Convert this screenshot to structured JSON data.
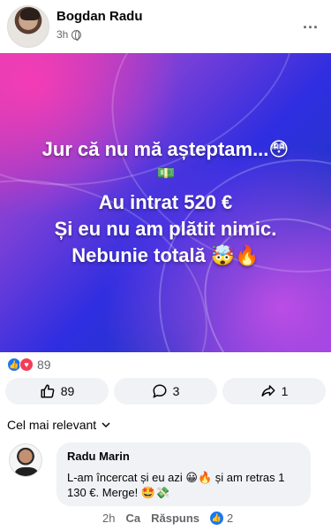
{
  "post": {
    "author": "Bogdan Radu",
    "time": "3h",
    "privacy_icon": "globe-icon",
    "more_icon": "more-options-icon",
    "more_label": "..."
  },
  "image": {
    "line1": "Jur că nu mă așteptam...😳",
    "money_emoji": "💵",
    "line2": "Au intrat 520 €",
    "line3": "Și eu nu am plătit nimic.",
    "line4": "Nebunie totală 🤯🔥",
    "colors": {
      "primary": "#2f2ee0",
      "accent": "#d23fb0"
    }
  },
  "reactions": {
    "count": "89",
    "icons": [
      "like-icon",
      "love-icon"
    ]
  },
  "actions": {
    "like_count": "89",
    "comment_count": "3",
    "share_count": "1"
  },
  "sort": {
    "label": "Cel mai relevant"
  },
  "comment": {
    "author": "Radu Marin",
    "text": "L-am încercat și eu azi 😀🔥 și am retras 1 130 €. Merge! 🤩💸",
    "time": "2h",
    "like_label": "Ca",
    "reply_label": "Răspuns",
    "like_count": "2"
  },
  "colors": {
    "facebook_blue": "#1877f2",
    "love_red": "#f33e58",
    "button_bg": "#f0f2f5"
  }
}
